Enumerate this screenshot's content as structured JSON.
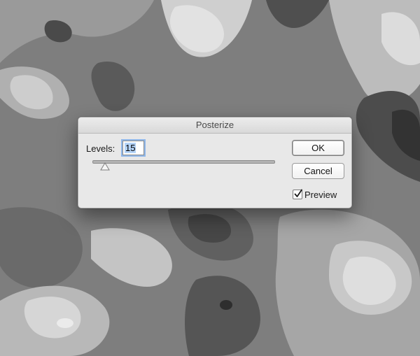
{
  "dialog": {
    "title": "Posterize",
    "levels_label": "Levels:",
    "levels_value": "15",
    "slider_level": 0.07,
    "ok_label": "OK",
    "cancel_label": "Cancel",
    "preview_label": "Preview",
    "preview_checked": true
  },
  "colors": {
    "background_gray": "#8a8a8a",
    "dialog_bg": "#e8e8e8",
    "selection": "#b4d3f7",
    "focus_ring": "#8fb7ea"
  },
  "icons": {
    "slider_thumb": "triangle-thumb-icon",
    "checkmark": "checkmark-icon"
  }
}
